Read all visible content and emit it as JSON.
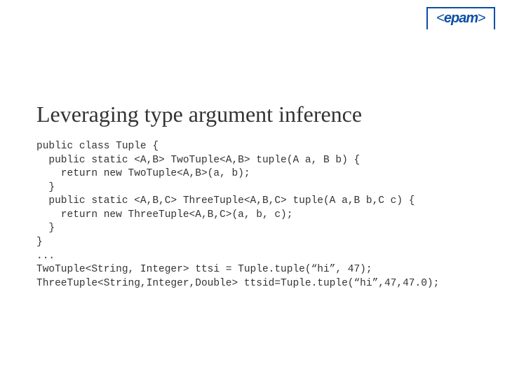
{
  "logo": {
    "lt": "<",
    "name": "epam",
    "gt": ">"
  },
  "title": "Leveraging type argument inference",
  "code": "public class Tuple {\n  public static <A,B> TwoTuple<A,B> tuple(A a, B b) {\n    return new TwoTuple<A,B>(a, b);\n  }\n  public static <A,B,C> ThreeTuple<A,B,C> tuple(A a,B b,C c) {\n    return new ThreeTuple<A,B,C>(a, b, c);\n  }\n}    \n...\nTwoTuple<String, Integer> ttsi = Tuple.tuple(“hi”, 47);\nThreeTuple<String,Integer,Double> ttsid=Tuple.tuple(“hi”,47,47.0);"
}
